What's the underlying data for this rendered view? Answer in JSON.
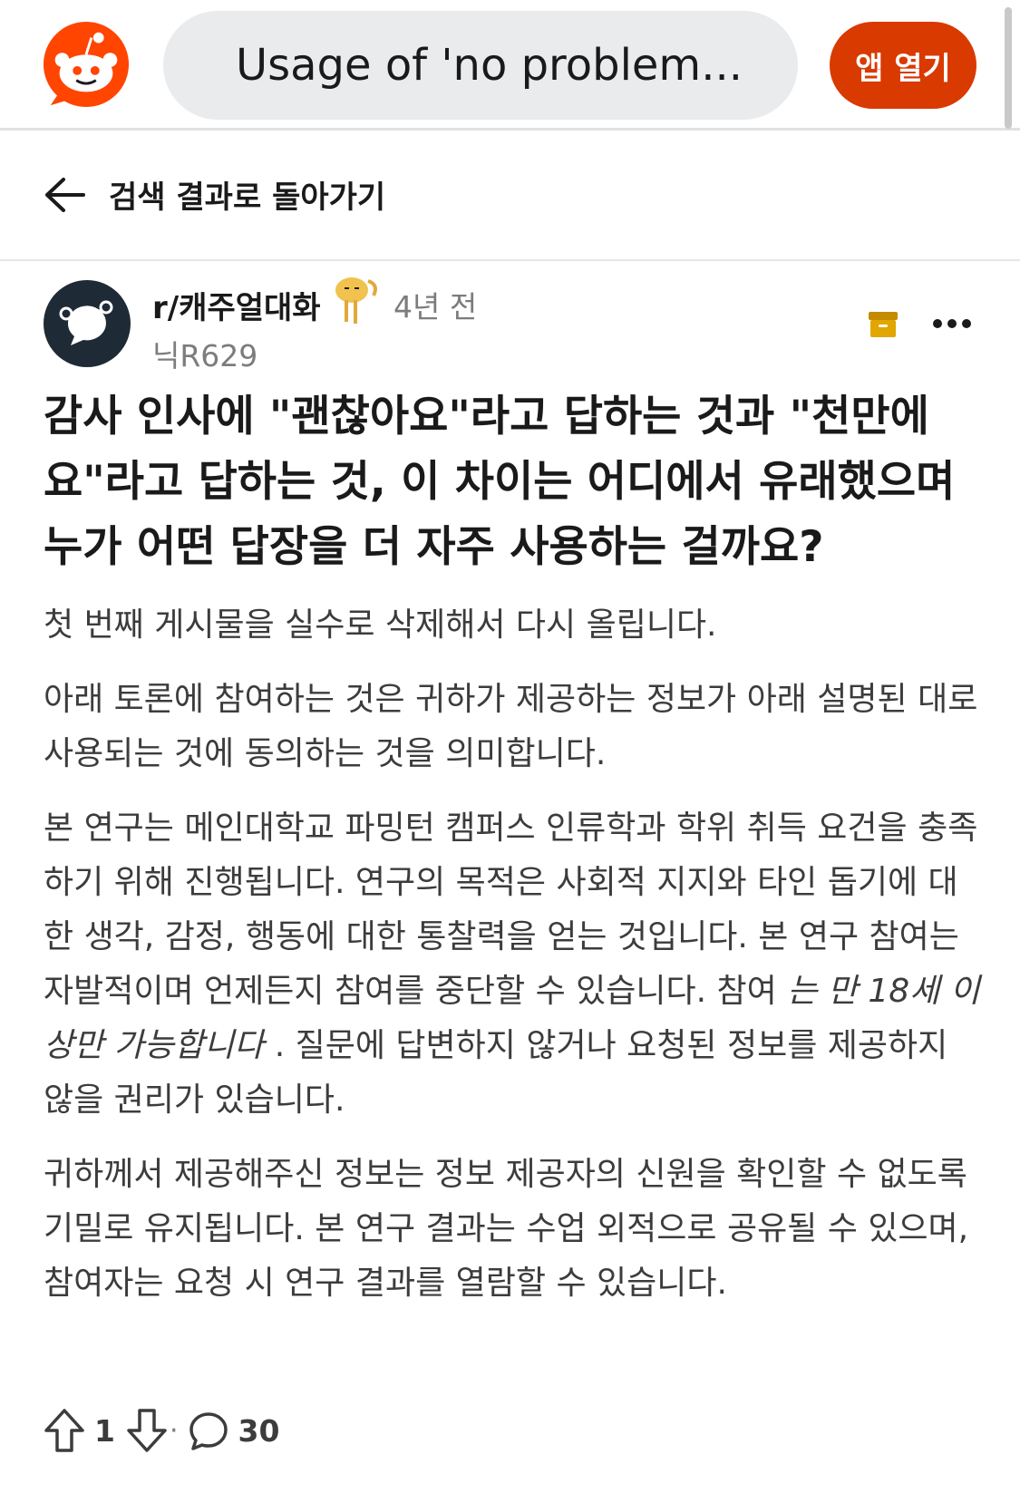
{
  "header": {
    "search_text": "Usage of 'no problem...",
    "open_app_label": "앱 열기",
    "brand_color": "#d93a00"
  },
  "nav": {
    "back_label": "검색 결과로 돌아가기"
  },
  "post": {
    "community": "r/캐주얼대화",
    "time": "4년 전",
    "author": "닉R629",
    "title": "감사 인사에 \"괜찮아요\"라고 답하는 것과 \"천만에요\"라고 답하는 것, 이 차이는 어디에서 유래했으며 누가 어떤 답장을 더 자주 사용하는 걸까요?",
    "body": {
      "p1": "첫 번째 게시물을 실수로 삭제해서 다시 올립니다.",
      "p2": "아래 토론에 참여하는 것은 귀하가 제공하는 정보가 아래 설명된 대로 사용되는 것에 동의하는 것을 의미합니다.",
      "p3_a": "본 연구는 메인대학교 파밍턴 캠퍼스 인류학과 학위 취득 요건을 충족하기 위해 진행됩니다. 연구의 목적은 사회적 지지와 타인 돕기에 대한 생각, 감정, 행동에 대한 통찰력을 얻는 것입니다. 본 연구 참여는 자발적이며 언제든지 참여를 중단할 수 있습니다. 참여 ",
      "p3_em": "는 만 18세 이상만 가능합니다",
      "p3_b": " . 질문에 답변하지 않거나 요청된 정보를 제공하지 않을 권리가 있습니다.",
      "p4": "귀하께서 제공해주신 정보는 정보 제공자의 신원을 확인할 수 없도록 기밀로 유지됩니다. 본 연구 결과는 수업 외적으로 공유될 수 있으며, 참여자는 요청 시 연구 결과를 열람할 수 있습니다."
    },
    "upvotes": "1",
    "separator": "·",
    "comments": "30"
  },
  "icons": {
    "logo": "reddit-logo-icon",
    "back": "arrow-left-icon",
    "avatar": "community-chat-icon",
    "award": "award-icon",
    "archive": "archive-icon",
    "more": "more-dots-icon",
    "upvote": "upvote-arrow-icon",
    "downvote": "downvote-arrow-icon",
    "comment": "comment-bubble-icon"
  }
}
